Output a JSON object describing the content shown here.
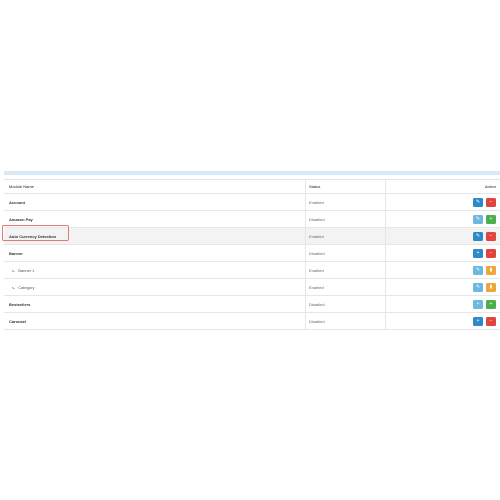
{
  "table": {
    "headers": {
      "name": "Module Name",
      "status": "Status",
      "action": "Action"
    },
    "rows": [
      {
        "name": "Account",
        "status": "Enabled",
        "level": 0,
        "highlight": false,
        "buttons": [
          {
            "icon": "pencil-icon",
            "color": "#2b8ac7"
          },
          {
            "icon": "minus-icon",
            "color": "#e0463f"
          }
        ]
      },
      {
        "name": "Amazon Pay",
        "status": "Disabled",
        "level": 0,
        "highlight": false,
        "buttons": [
          {
            "icon": "pencil-icon",
            "color": "#6cb8e0"
          },
          {
            "icon": "plus-icon",
            "color": "#4cae4c"
          }
        ]
      },
      {
        "name": "Auto Currency Detection",
        "status": "Enabled",
        "level": 0,
        "highlight": true,
        "buttons": [
          {
            "icon": "pencil-icon",
            "color": "#2b8ac7"
          },
          {
            "icon": "minus-icon",
            "color": "#e0463f"
          }
        ]
      },
      {
        "name": "Banner",
        "status": "Disabled",
        "level": 0,
        "highlight": false,
        "buttons": [
          {
            "icon": "plus-icon",
            "color": "#2b8ac7"
          },
          {
            "icon": "minus-icon",
            "color": "#e0463f"
          }
        ]
      },
      {
        "name": "Banner 1",
        "status": "Enabled",
        "level": 1,
        "highlight": false,
        "buttons": [
          {
            "icon": "pencil-icon",
            "color": "#6cb8e0"
          },
          {
            "icon": "trash-icon",
            "color": "#f0a53a"
          }
        ]
      },
      {
        "name": "Category",
        "status": "Enabled",
        "level": 1,
        "highlight": false,
        "buttons": [
          {
            "icon": "pencil-icon",
            "color": "#6cb8e0"
          },
          {
            "icon": "trash-icon",
            "color": "#f0a53a"
          }
        ]
      },
      {
        "name": "Bestsellers",
        "status": "Disabled",
        "level": 0,
        "highlight": false,
        "buttons": [
          {
            "icon": "plus-icon",
            "color": "#6cb8e0"
          },
          {
            "icon": "plus-icon",
            "color": "#4cae4c"
          }
        ]
      },
      {
        "name": "Carousel",
        "status": "Disabled",
        "level": 0,
        "highlight": false,
        "buttons": [
          {
            "icon": "plus-icon",
            "color": "#2b8ac7"
          },
          {
            "icon": "minus-icon",
            "color": "#e0463f"
          }
        ]
      }
    ]
  },
  "icons": {
    "pencil-icon": "✎",
    "plus-icon": "+",
    "minus-icon": "−",
    "trash-icon": "▮",
    "branch-icon": "⤷"
  },
  "colors": {
    "accent_bar": "#d9e8f5",
    "focus_border": "#e07a7a"
  }
}
